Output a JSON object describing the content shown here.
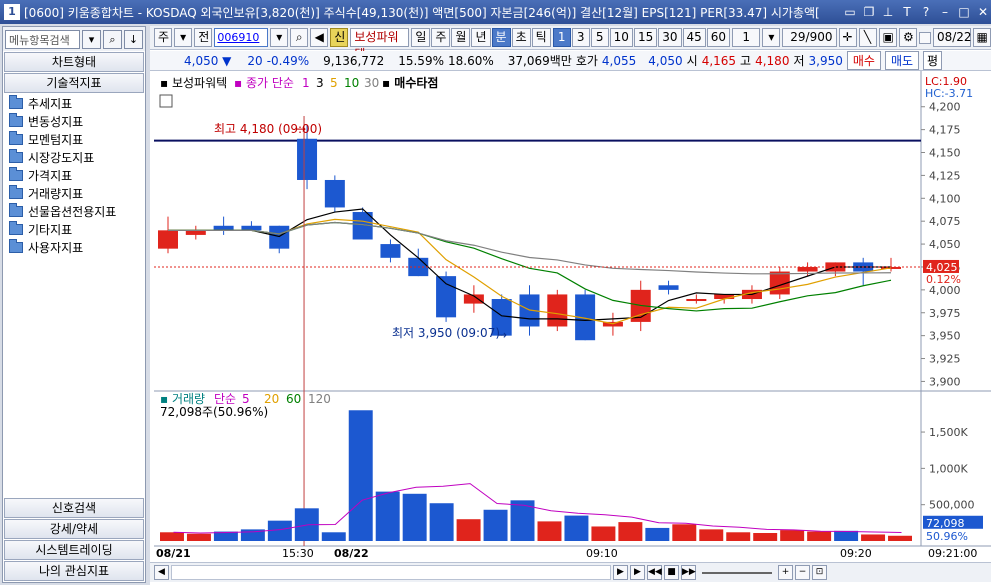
{
  "window": {
    "title": "[0600] 키움종합차트 - KOSDAQ 외국인보유[3,820(천)] 주식수[49,130(천)] 액면[500] 자본금[246(억)] 결산[12월] EPS[121] PER[33.47] 시가총액[",
    "app_icon": "1"
  },
  "left_panel": {
    "search_placeholder": "메뉴항목검색",
    "sections": {
      "chart_type": "차트형태",
      "tech": "기술적지표"
    },
    "tree": [
      "추세지표",
      "변동성지표",
      "모멘텀지표",
      "시장강도지표",
      "가격지표",
      "거래량지표",
      "선물옵션전용지표",
      "기타지표",
      "사용자지표"
    ],
    "bottom": [
      "신호검색",
      "강세/약세",
      "시스템트레이딩",
      "나의 관심지표"
    ]
  },
  "toolbar": {
    "period_labels": [
      "주",
      "전"
    ],
    "code": "006910",
    "name": "보성파워텍",
    "name_badge": "신",
    "periods": [
      "일",
      "주",
      "월",
      "년",
      "분",
      "초",
      "틱"
    ],
    "selected_period": "분",
    "intervals": [
      "1",
      "3",
      "5",
      "10",
      "15",
      "30",
      "45",
      "60"
    ],
    "selected_interval": "1",
    "multiplier": "1",
    "count": "29/900",
    "date": "08/22"
  },
  "quote": {
    "price": "4,050 ▼",
    "change": "20",
    "change_pct": "-0.49%",
    "volume": "9,136,772",
    "turnover_rate": "15.59%",
    "rate2": "18.60%",
    "amount": "37,069백만",
    "ask_label": "호가",
    "ask1": "4,055",
    "ask2": "4,050",
    "open_label": "시",
    "open": "4,165",
    "high_label": "고",
    "high": "4,180",
    "low_label": "저",
    "low": "3,950",
    "buy": "매수",
    "sell": "매도",
    "eval": "평"
  },
  "chart_data": {
    "type": "candlestick",
    "legend_price": {
      "name": "보성파워텍",
      "ma_label": "종가 단순",
      "ma": [
        "1",
        "3",
        "5",
        "10",
        "30"
      ],
      "signal": "매수타점"
    },
    "y_axis": {
      "ticks": [
        "4,200",
        "4,175",
        "4,150",
        "4,125",
        "4,100",
        "4,075",
        "4,050",
        "4,025",
        "4,000",
        "3,975",
        "3,950",
        "3,925",
        "3,900"
      ],
      "ylim": [
        3895,
        4215
      ],
      "current": "4,025",
      "current_pct": "0.12%",
      "lc": "LC:1.90",
      "hc": "HC:-3.71"
    },
    "annot_high": "최고 4,180 (09:00)",
    "annot_low": "최저 3,950 (09:07)",
    "ref_line": 4163,
    "x_labels": [
      "08/21",
      "15:30",
      "08/22",
      "09:10",
      "09:20",
      "09:21:00"
    ],
    "candles": [
      {
        "o": 4045,
        "h": 4080,
        "l": 4040,
        "c": 4065
      },
      {
        "o": 4060,
        "h": 4070,
        "l": 4055,
        "c": 4065
      },
      {
        "o": 4070,
        "h": 4080,
        "l": 4060,
        "c": 4065
      },
      {
        "o": 4070,
        "h": 4075,
        "l": 4065,
        "c": 4065
      },
      {
        "o": 4070,
        "h": 4070,
        "l": 4040,
        "c": 4045
      },
      {
        "o": 4165,
        "h": 4180,
        "l": 4110,
        "c": 4120
      },
      {
        "o": 4120,
        "h": 4125,
        "l": 4085,
        "c": 4090
      },
      {
        "o": 4085,
        "h": 4090,
        "l": 4055,
        "c": 4055
      },
      {
        "o": 4050,
        "h": 4055,
        "l": 4030,
        "c": 4035
      },
      {
        "o": 4035,
        "h": 4045,
        "l": 4015,
        "c": 4015
      },
      {
        "o": 4015,
        "h": 4020,
        "l": 3965,
        "c": 3970
      },
      {
        "o": 3985,
        "h": 4005,
        "l": 3975,
        "c": 3995
      },
      {
        "o": 3990,
        "h": 3995,
        "l": 3950,
        "c": 3950
      },
      {
        "o": 3995,
        "h": 4005,
        "l": 3950,
        "c": 3960
      },
      {
        "o": 3960,
        "h": 4000,
        "l": 3955,
        "c": 3995
      },
      {
        "o": 3995,
        "h": 4000,
        "l": 3945,
        "c": 3945
      },
      {
        "o": 3960,
        "h": 3975,
        "l": 3950,
        "c": 3965
      },
      {
        "o": 3965,
        "h": 4010,
        "l": 3955,
        "c": 4000
      },
      {
        "o": 4005,
        "h": 4010,
        "l": 3995,
        "c": 4000
      },
      {
        "o": 3990,
        "h": 3995,
        "l": 3985,
        "c": 3990
      },
      {
        "o": 3990,
        "h": 3995,
        "l": 3985,
        "c": 3995
      },
      {
        "o": 3990,
        "h": 4005,
        "l": 3985,
        "c": 4000
      },
      {
        "o": 3995,
        "h": 4025,
        "l": 3990,
        "c": 4020
      },
      {
        "o": 4020,
        "h": 4030,
        "l": 4015,
        "c": 4025
      },
      {
        "o": 4020,
        "h": 4030,
        "l": 4015,
        "c": 4030
      },
      {
        "o": 4030,
        "h": 4035,
        "l": 4005,
        "c": 4020
      },
      {
        "o": 4025,
        "h": 4035,
        "l": 4020,
        "c": 4025
      }
    ],
    "volume_panel": {
      "label": "거래량",
      "ma_label": "단순",
      "ma": [
        "5",
        "20",
        "60",
        "120"
      ],
      "info": "72,098주(50.96%)",
      "ticks": [
        "1,500K",
        "1,000K",
        "500,000"
      ],
      "current": "72,098",
      "current_pct": "50.96%",
      "values": [
        120,
        100,
        130,
        160,
        280,
        450,
        120,
        1800,
        680,
        650,
        520,
        300,
        430,
        560,
        270,
        350,
        200,
        260,
        180,
        230,
        160,
        120,
        110,
        150,
        130,
        140,
        90,
        72
      ]
    }
  }
}
